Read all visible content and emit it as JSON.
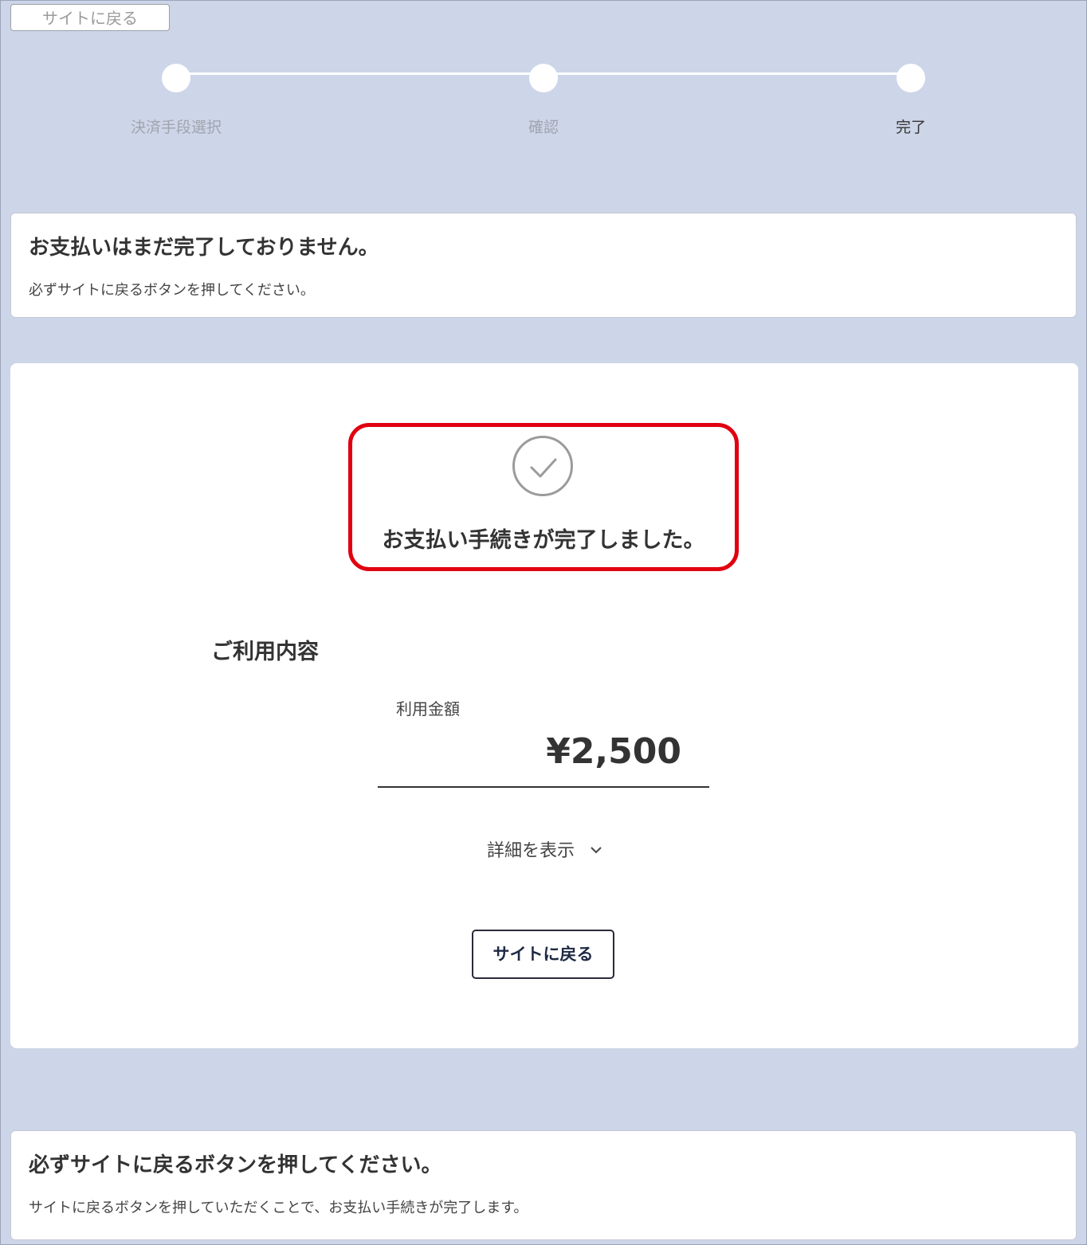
{
  "header": {
    "back_label": "サイトに戻る"
  },
  "stepper": {
    "steps": [
      {
        "label": "決済手段選択",
        "state": "done"
      },
      {
        "label": "確認",
        "state": "done"
      },
      {
        "label": "完了",
        "state": "current"
      }
    ]
  },
  "top_notice": {
    "title": "お支払いはまだ完了しておりません。",
    "body": "必ずサイトに戻るボタンを押してください。"
  },
  "main": {
    "icon": "check-circle-icon",
    "complete_message": "お支払い手続きが完了しました。",
    "usage_title": "ご利用内容",
    "amount_label": "利用金額",
    "amount_value": "¥2,500",
    "details_label": "詳細を表示",
    "back_button_label": "サイトに戻る"
  },
  "bottom_notice": {
    "title": "必ずサイトに戻るボタンを押してください。",
    "body": "サイトに戻るボタンを押していただくことで、お支払い手続きが完了します。"
  },
  "colors": {
    "background": "#cdd5e8",
    "highlight": "#e0000f",
    "card": "#ffffff"
  }
}
